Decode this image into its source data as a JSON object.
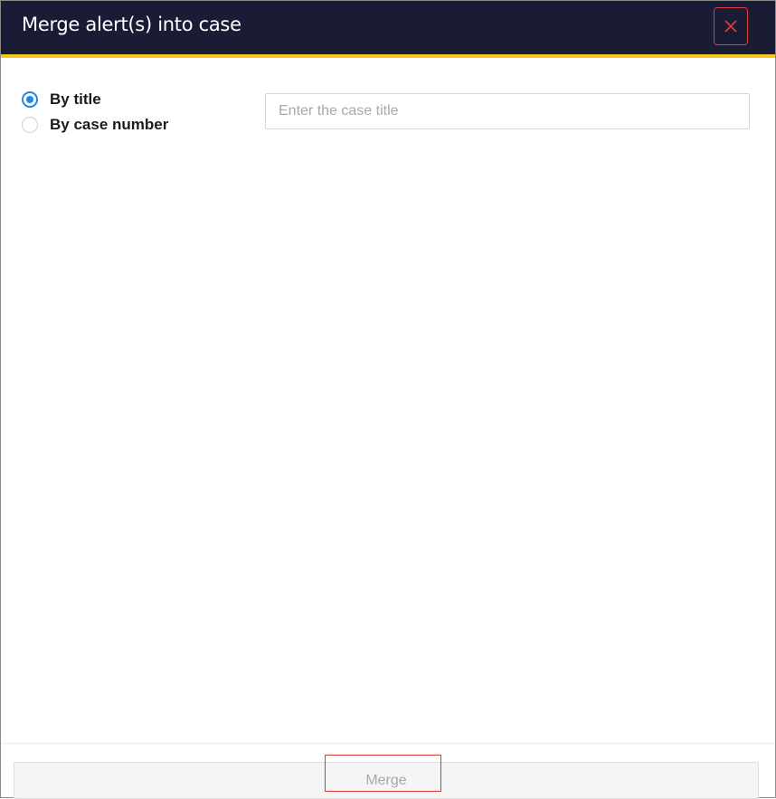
{
  "dialog": {
    "title": "Merge alert(s) into case",
    "close_icon": "close-icon",
    "colors": {
      "header_bg": "#1a1c35",
      "accent": "#f2c81f",
      "close": "#e03a3a",
      "radio_selected": "#1e88e5"
    }
  },
  "search_mode": {
    "options": [
      {
        "label": "By title",
        "selected": true
      },
      {
        "label": "By case number",
        "selected": false
      }
    ]
  },
  "case_search": {
    "value": "",
    "placeholder": "Enter the case title"
  },
  "footer": {
    "merge_label": "Merge"
  }
}
